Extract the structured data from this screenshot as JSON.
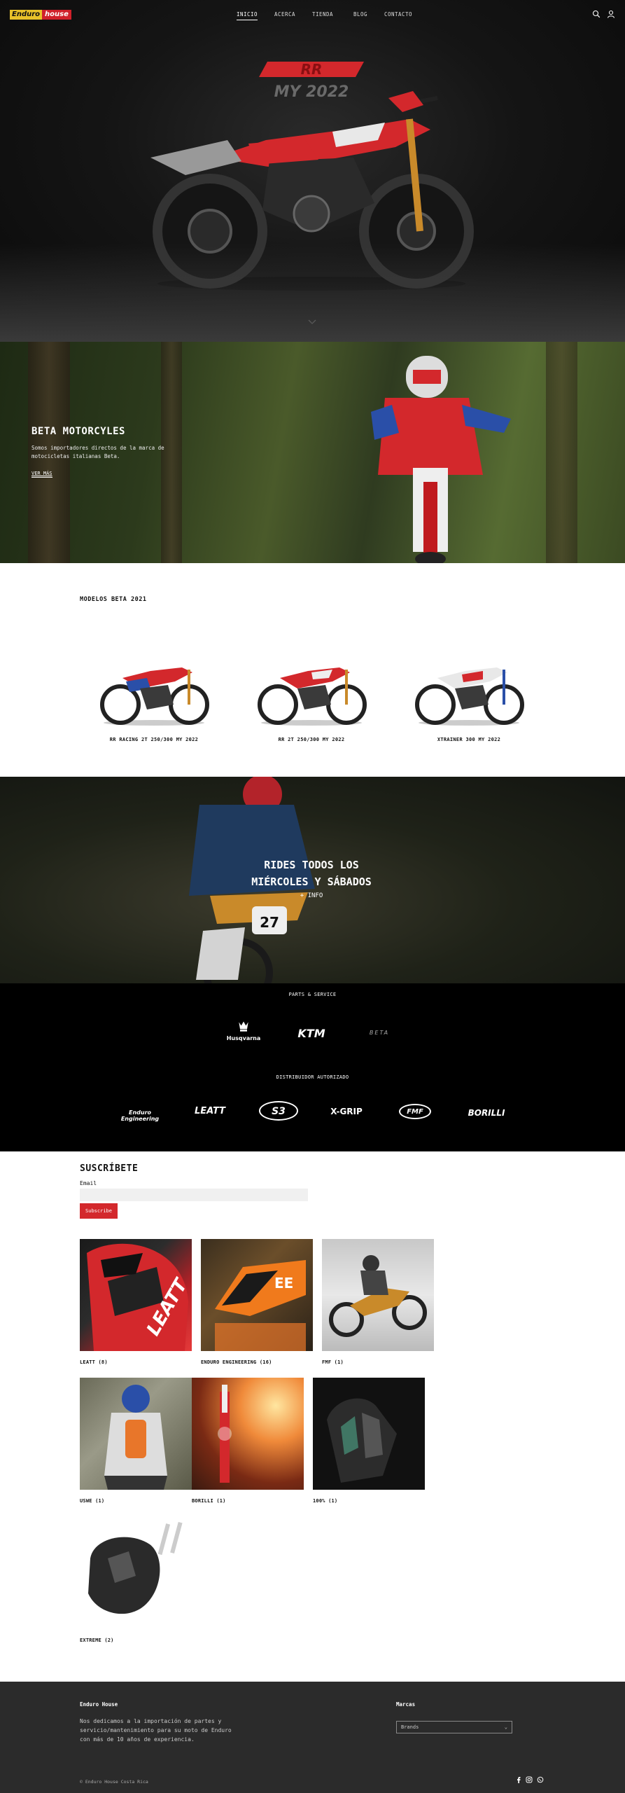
{
  "header": {
    "logo_part1": "Enduro",
    "logo_part2": "house",
    "nav": [
      "INICIO",
      "ACERCA",
      "TIENDA",
      "BLOG",
      "CONTACTO"
    ],
    "active_nav": "INICIO",
    "icons": [
      "search-icon",
      "user-icon"
    ]
  },
  "hero": {
    "badge_top": "RR",
    "badge_sub": "MY 2022",
    "scroll_icon": "chevron-down-icon"
  },
  "beta": {
    "title": "BETA MOTORCYLES",
    "text": "Somos importadores directos de la marca de motocicletas italianas Beta.",
    "link": "VER MÁS"
  },
  "models": {
    "title": "MODELOS BETA 2021",
    "items": [
      {
        "caption": "RR RACING 2T 250/300 MY 2022"
      },
      {
        "caption": "RR 2T 250/300 MY 2022"
      },
      {
        "caption": "XTRAINER 300 MY 2022"
      }
    ]
  },
  "rides": {
    "title_line1": "RIDES TODOS LOS",
    "title_line2": "MIÉRCOLES Y SÁBADOS",
    "info": "+ INFO"
  },
  "brands": {
    "parts_label": "PARTS & SERVICE",
    "parts": [
      "Husqvarna",
      "KTM",
      "BETA"
    ],
    "dist_label": "DISTRIBUIDOR AUTORIZADO",
    "distributors": [
      "Enduro Engineering",
      "LEATT",
      "S3",
      "X-GRIP",
      "FMF",
      "BORILLI"
    ]
  },
  "subscribe": {
    "title": "SUSCRÍBETE",
    "email_label": "Email",
    "email_placeholder": "",
    "button": "Subscribe"
  },
  "categories": [
    {
      "caption": "LEATT (8)"
    },
    {
      "caption": "ENDURO ENGINEERING (16)"
    },
    {
      "caption": "FMF (1)"
    },
    {
      "caption": "USWE (1)"
    },
    {
      "caption": "BORILLI (1)"
    },
    {
      "caption": "100% (1)"
    },
    {
      "caption": "EXTREME (2)"
    }
  ],
  "footer": {
    "title": "Enduro House",
    "text": "Nos dedicamos a la importación de partes y servicio/mantenimiento para su moto de Enduro con más de 10 años de experiencia.",
    "marcas_title": "Marcas",
    "select_value": "Brands",
    "copyright": "© Enduro House Costa Rica",
    "social": [
      "facebook-icon",
      "instagram-icon",
      "whatsapp-icon"
    ]
  },
  "colors": {
    "accent": "#d3282c",
    "logo_yellow": "#e8c22a",
    "footer_bg": "#2b2b2b"
  }
}
